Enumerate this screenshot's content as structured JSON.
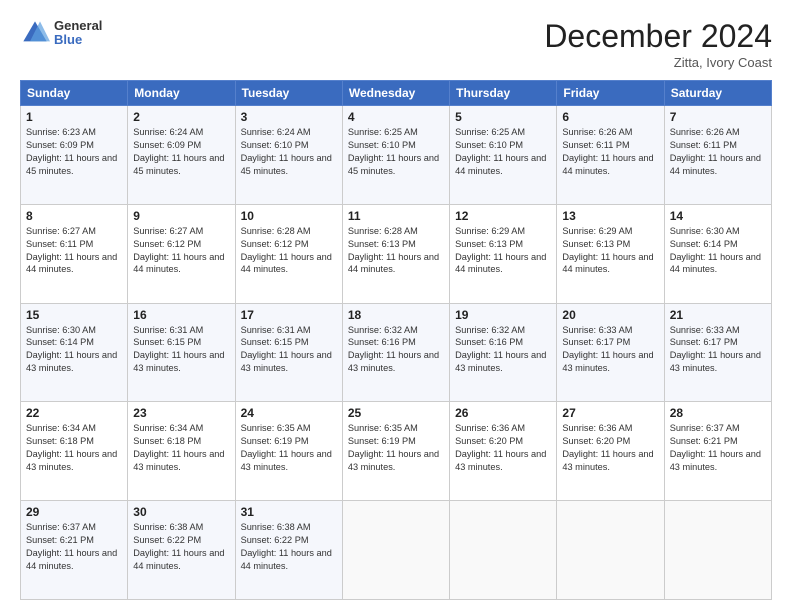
{
  "header": {
    "logo_general": "General",
    "logo_blue": "Blue",
    "month": "December 2024",
    "location": "Zitta, Ivory Coast"
  },
  "days_of_week": [
    "Sunday",
    "Monday",
    "Tuesday",
    "Wednesday",
    "Thursday",
    "Friday",
    "Saturday"
  ],
  "weeks": [
    [
      {
        "day": 1,
        "sunrise": "6:23 AM",
        "sunset": "6:09 PM",
        "daylight": "11 hours and 45 minutes."
      },
      {
        "day": 2,
        "sunrise": "6:24 AM",
        "sunset": "6:09 PM",
        "daylight": "11 hours and 45 minutes."
      },
      {
        "day": 3,
        "sunrise": "6:24 AM",
        "sunset": "6:10 PM",
        "daylight": "11 hours and 45 minutes."
      },
      {
        "day": 4,
        "sunrise": "6:25 AM",
        "sunset": "6:10 PM",
        "daylight": "11 hours and 45 minutes."
      },
      {
        "day": 5,
        "sunrise": "6:25 AM",
        "sunset": "6:10 PM",
        "daylight": "11 hours and 44 minutes."
      },
      {
        "day": 6,
        "sunrise": "6:26 AM",
        "sunset": "6:11 PM",
        "daylight": "11 hours and 44 minutes."
      },
      {
        "day": 7,
        "sunrise": "6:26 AM",
        "sunset": "6:11 PM",
        "daylight": "11 hours and 44 minutes."
      }
    ],
    [
      {
        "day": 8,
        "sunrise": "6:27 AM",
        "sunset": "6:11 PM",
        "daylight": "11 hours and 44 minutes."
      },
      {
        "day": 9,
        "sunrise": "6:27 AM",
        "sunset": "6:12 PM",
        "daylight": "11 hours and 44 minutes."
      },
      {
        "day": 10,
        "sunrise": "6:28 AM",
        "sunset": "6:12 PM",
        "daylight": "11 hours and 44 minutes."
      },
      {
        "day": 11,
        "sunrise": "6:28 AM",
        "sunset": "6:13 PM",
        "daylight": "11 hours and 44 minutes."
      },
      {
        "day": 12,
        "sunrise": "6:29 AM",
        "sunset": "6:13 PM",
        "daylight": "11 hours and 44 minutes."
      },
      {
        "day": 13,
        "sunrise": "6:29 AM",
        "sunset": "6:13 PM",
        "daylight": "11 hours and 44 minutes."
      },
      {
        "day": 14,
        "sunrise": "6:30 AM",
        "sunset": "6:14 PM",
        "daylight": "11 hours and 44 minutes."
      }
    ],
    [
      {
        "day": 15,
        "sunrise": "6:30 AM",
        "sunset": "6:14 PM",
        "daylight": "11 hours and 43 minutes."
      },
      {
        "day": 16,
        "sunrise": "6:31 AM",
        "sunset": "6:15 PM",
        "daylight": "11 hours and 43 minutes."
      },
      {
        "day": 17,
        "sunrise": "6:31 AM",
        "sunset": "6:15 PM",
        "daylight": "11 hours and 43 minutes."
      },
      {
        "day": 18,
        "sunrise": "6:32 AM",
        "sunset": "6:16 PM",
        "daylight": "11 hours and 43 minutes."
      },
      {
        "day": 19,
        "sunrise": "6:32 AM",
        "sunset": "6:16 PM",
        "daylight": "11 hours and 43 minutes."
      },
      {
        "day": 20,
        "sunrise": "6:33 AM",
        "sunset": "6:17 PM",
        "daylight": "11 hours and 43 minutes."
      },
      {
        "day": 21,
        "sunrise": "6:33 AM",
        "sunset": "6:17 PM",
        "daylight": "11 hours and 43 minutes."
      }
    ],
    [
      {
        "day": 22,
        "sunrise": "6:34 AM",
        "sunset": "6:18 PM",
        "daylight": "11 hours and 43 minutes."
      },
      {
        "day": 23,
        "sunrise": "6:34 AM",
        "sunset": "6:18 PM",
        "daylight": "11 hours and 43 minutes."
      },
      {
        "day": 24,
        "sunrise": "6:35 AM",
        "sunset": "6:19 PM",
        "daylight": "11 hours and 43 minutes."
      },
      {
        "day": 25,
        "sunrise": "6:35 AM",
        "sunset": "6:19 PM",
        "daylight": "11 hours and 43 minutes."
      },
      {
        "day": 26,
        "sunrise": "6:36 AM",
        "sunset": "6:20 PM",
        "daylight": "11 hours and 43 minutes."
      },
      {
        "day": 27,
        "sunrise": "6:36 AM",
        "sunset": "6:20 PM",
        "daylight": "11 hours and 43 minutes."
      },
      {
        "day": 28,
        "sunrise": "6:37 AM",
        "sunset": "6:21 PM",
        "daylight": "11 hours and 43 minutes."
      }
    ],
    [
      {
        "day": 29,
        "sunrise": "6:37 AM",
        "sunset": "6:21 PM",
        "daylight": "11 hours and 44 minutes."
      },
      {
        "day": 30,
        "sunrise": "6:38 AM",
        "sunset": "6:22 PM",
        "daylight": "11 hours and 44 minutes."
      },
      {
        "day": 31,
        "sunrise": "6:38 AM",
        "sunset": "6:22 PM",
        "daylight": "11 hours and 44 minutes."
      },
      null,
      null,
      null,
      null
    ]
  ]
}
